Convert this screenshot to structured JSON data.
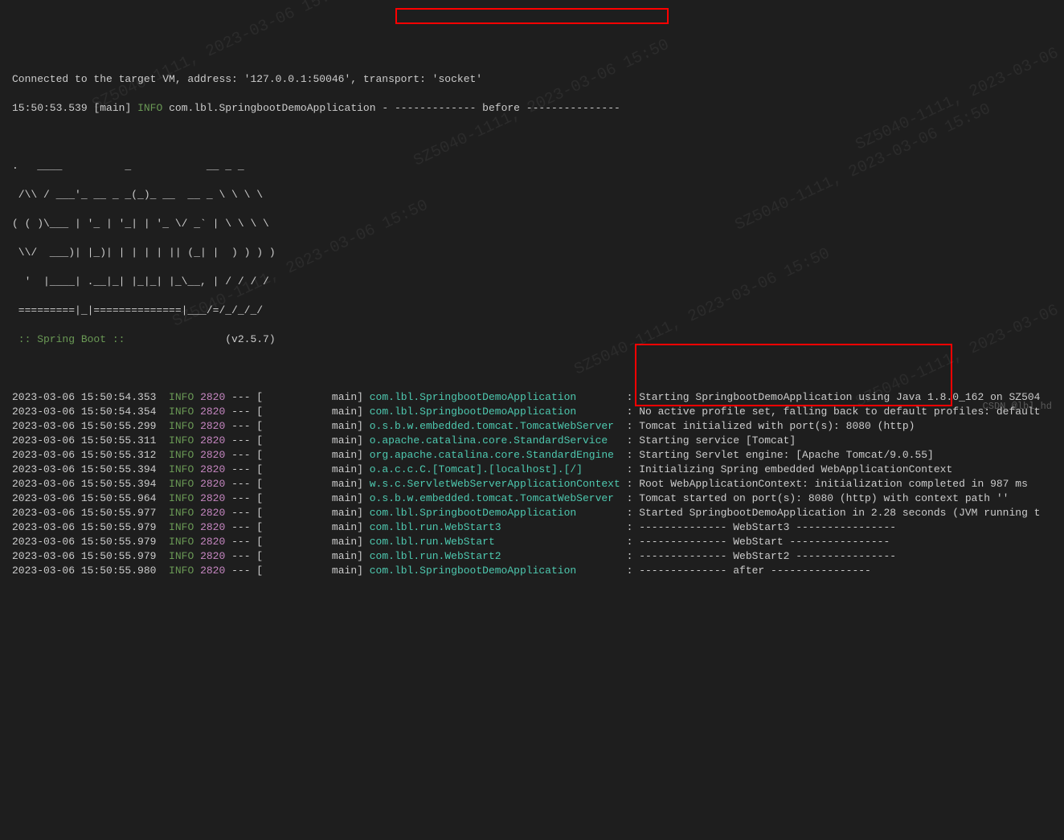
{
  "header": {
    "line1": "Connected to the target VM, address: '127.0.0.1:50046', transport: 'socket'",
    "line2_ts": "15:50:53.539",
    "line2_thread": "[main]",
    "line2_level": "INFO",
    "line2_logger": "com.lbl.SpringbootDemoApplication",
    "line2_msg": "- ------------- before ---------------"
  },
  "ascii_art": [
    ".   ____          _            __ _ _",
    " /\\\\ / ___'_ __ _ _(_)_ __  __ _ \\ \\ \\ \\",
    "( ( )\\___ | '_ | '_| | '_ \\/ _` | \\ \\ \\ \\",
    " \\\\/  ___)| |_)| | | | | || (_| |  ) ) ) )",
    "  '  |____| .__|_| |_|_| |_\\__, | / / / /",
    " =========|_|==============|___/=/_/_/_/"
  ],
  "spring_boot": {
    "label": " :: Spring Boot :: ",
    "version": "               (v2.5.7)"
  },
  "logs": [
    {
      "ts": "2023-03-06 15:50:54.353",
      "level": "INFO",
      "pid": "2820",
      "thread": "main",
      "logger": "com.lbl.SpringbootDemoApplication",
      "msg": "Starting SpringbootDemoApplication using Java 1.8.0_162 on SZ504"
    },
    {
      "ts": "2023-03-06 15:50:54.354",
      "level": "INFO",
      "pid": "2820",
      "thread": "main",
      "logger": "com.lbl.SpringbootDemoApplication",
      "msg": "No active profile set, falling back to default profiles: default"
    },
    {
      "ts": "2023-03-06 15:50:55.299",
      "level": "INFO",
      "pid": "2820",
      "thread": "main",
      "logger": "o.s.b.w.embedded.tomcat.TomcatWebServer",
      "msg": "Tomcat initialized with port(s): 8080 (http)"
    },
    {
      "ts": "2023-03-06 15:50:55.311",
      "level": "INFO",
      "pid": "2820",
      "thread": "main",
      "logger": "o.apache.catalina.core.StandardService",
      "msg": "Starting service [Tomcat]"
    },
    {
      "ts": "2023-03-06 15:50:55.312",
      "level": "INFO",
      "pid": "2820",
      "thread": "main",
      "logger": "org.apache.catalina.core.StandardEngine",
      "msg": "Starting Servlet engine: [Apache Tomcat/9.0.55]"
    },
    {
      "ts": "2023-03-06 15:50:55.394",
      "level": "INFO",
      "pid": "2820",
      "thread": "main",
      "logger": "o.a.c.c.C.[Tomcat].[localhost].[/]",
      "msg": "Initializing Spring embedded WebApplicationContext"
    },
    {
      "ts": "2023-03-06 15:50:55.394",
      "level": "INFO",
      "pid": "2820",
      "thread": "main",
      "logger": "w.s.c.ServletWebServerApplicationContext",
      "msg": "Root WebApplicationContext: initialization completed in 987 ms"
    },
    {
      "ts": "2023-03-06 15:50:55.964",
      "level": "INFO",
      "pid": "2820",
      "thread": "main",
      "logger": "o.s.b.w.embedded.tomcat.TomcatWebServer",
      "msg": "Tomcat started on port(s): 8080 (http) with context path ''"
    },
    {
      "ts": "2023-03-06 15:50:55.977",
      "level": "INFO",
      "pid": "2820",
      "thread": "main",
      "logger": "com.lbl.SpringbootDemoApplication",
      "msg": "Started SpringbootDemoApplication in 2.28 seconds (JVM running t"
    },
    {
      "ts": "2023-03-06 15:50:55.979",
      "level": "INFO",
      "pid": "2820",
      "thread": "main",
      "logger": "com.lbl.run.WebStart3",
      "msg": "-------------- WebStart3 ----------------"
    },
    {
      "ts": "2023-03-06 15:50:55.979",
      "level": "INFO",
      "pid": "2820",
      "thread": "main",
      "logger": "com.lbl.run.WebStart",
      "msg": "-------------- WebStart ----------------"
    },
    {
      "ts": "2023-03-06 15:50:55.979",
      "level": "INFO",
      "pid": "2820",
      "thread": "main",
      "logger": "com.lbl.run.WebStart2",
      "msg": "-------------- WebStart2 ----------------"
    },
    {
      "ts": "2023-03-06 15:50:55.980",
      "level": "INFO",
      "pid": "2820",
      "thread": "main",
      "logger": "com.lbl.SpringbootDemoApplication",
      "msg": "-------------- after ----------------"
    }
  ],
  "watermark_text": "SZ5040-1111, 2023-03-06 15:50",
  "csdn": "CSDN @lbl_hd"
}
